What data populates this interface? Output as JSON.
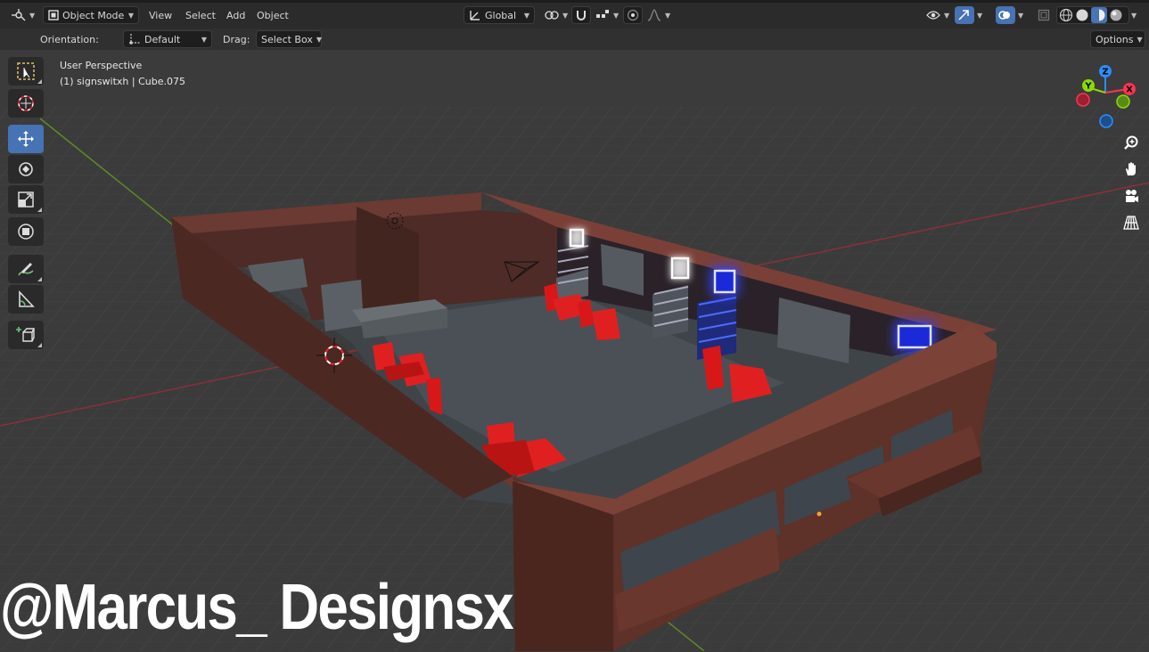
{
  "header": {
    "mode": "Object Mode",
    "menus": [
      "View",
      "Select",
      "Add",
      "Object"
    ],
    "transform_orientation": "Global"
  },
  "tool_settings": {
    "orientation_label": "Orientation:",
    "orientation_value": "Default",
    "drag_label": "Drag:",
    "drag_value": "Select Box",
    "options_label": "Options"
  },
  "viewport": {
    "perspective": "User Perspective",
    "object_info": "(1) signswitxh | Cube.075",
    "watermark": "@Marcus_ Designsx",
    "gizmo": {
      "z": "Z",
      "y": "Y",
      "x": "X"
    }
  },
  "toolbar": {
    "tools": [
      "select-box",
      "cursor",
      "move",
      "rotate",
      "scale",
      "transform",
      "annotate",
      "measure",
      "add-cube"
    ],
    "active_tool": "move"
  },
  "colors": {
    "accent": "#4772b3",
    "header_bg": "#2b2b2b",
    "viewport_bg": "#3a3a3a",
    "wall": "#5a302a",
    "seat": "#d81818",
    "sign_blue": "#2a3cff",
    "x_axis": "#ff3352",
    "y_axis": "#8bdc00",
    "z_axis": "#2890ff"
  }
}
